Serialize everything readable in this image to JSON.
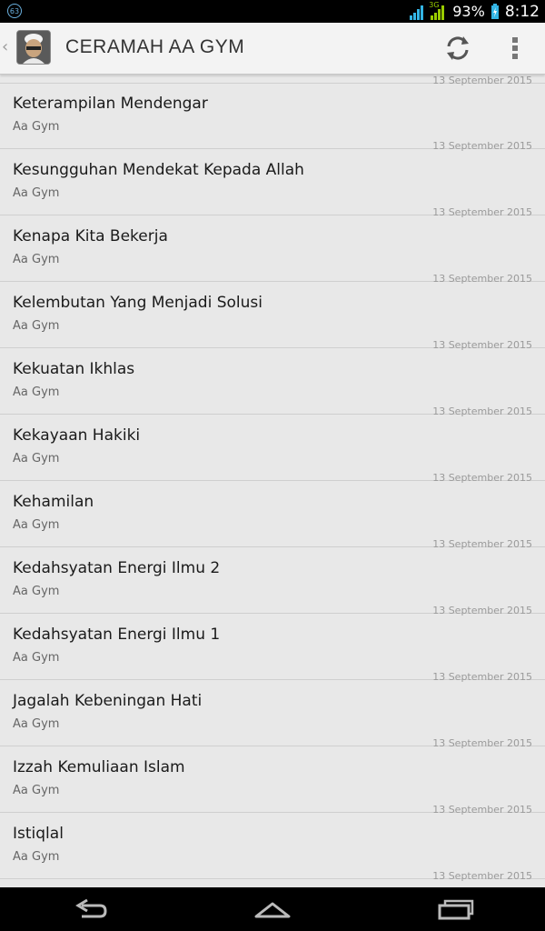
{
  "status_bar": {
    "notification_badge": "63",
    "network_type": "3G",
    "battery": "93%",
    "time": "8:12"
  },
  "action_bar": {
    "title": "CERAMAH AA GYM"
  },
  "partial_date": "13 September 2015",
  "items": [
    {
      "title": "Keterampilan Mendengar",
      "author": "Aa Gym",
      "date": "13 September 2015"
    },
    {
      "title": "Kesungguhan Mendekat Kepada Allah",
      "author": "Aa Gym",
      "date": "13 September 2015"
    },
    {
      "title": "Kenapa Kita Bekerja",
      "author": "Aa Gym",
      "date": "13 September 2015"
    },
    {
      "title": "Kelembutan Yang Menjadi Solusi",
      "author": "Aa Gym",
      "date": "13 September 2015"
    },
    {
      "title": "Kekuatan Ikhlas",
      "author": "Aa Gym",
      "date": "13 September 2015"
    },
    {
      "title": "Kekayaan Hakiki",
      "author": "Aa Gym",
      "date": "13 September 2015"
    },
    {
      "title": "Kehamilan",
      "author": "Aa Gym",
      "date": "13 September 2015"
    },
    {
      "title": "Kedahsyatan Energi Ilmu 2",
      "author": "Aa Gym",
      "date": "13 September 2015"
    },
    {
      "title": "Kedahsyatan Energi Ilmu 1",
      "author": "Aa Gym",
      "date": "13 September 2015"
    },
    {
      "title": "Jagalah Kebeningan Hati",
      "author": "Aa Gym",
      "date": "13 September 2015"
    },
    {
      "title": "Izzah Kemuliaan Islam",
      "author": "Aa Gym",
      "date": "13 September 2015"
    },
    {
      "title": "Istiqlal",
      "author": "Aa Gym",
      "date": "13 September 2015"
    }
  ],
  "icons": {
    "refresh": "refresh-icon",
    "overflow": "overflow-menu-icon",
    "back": "back-icon",
    "home": "home-icon",
    "recents": "recent-apps-icon"
  }
}
